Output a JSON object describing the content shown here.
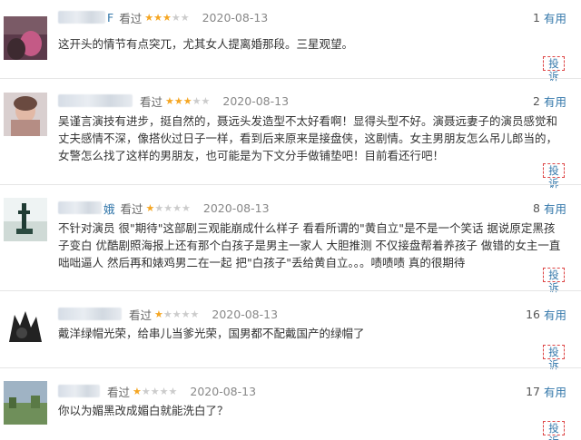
{
  "reviews": [
    {
      "username_suffix": "F",
      "seen_label": "看过",
      "rating": 3,
      "date": "2020-08-13",
      "votes": "1",
      "useful_label": "有用",
      "text": "这开头的情节有点突兀，尤其女人提离婚那段。三星观望。",
      "report_label": "投诉"
    },
    {
      "username_suffix": "",
      "seen_label": "看过",
      "rating": 3,
      "date": "2020-08-13",
      "votes": "2",
      "useful_label": "有用",
      "text": "吴谨言演技有进步，挺自然的，聂远头发造型不太好看啊！显得头型不好。演聂远妻子的演员感觉和丈夫感情不深，像搭伙过日子一样，看到后来原来是接盘侠，这剧情。女主男朋友怎么吊儿郎当的，女警怎么找了这样的男朋友，也可能是为下文分手做铺垫吧！目前看还行吧！",
      "report_label": "投诉"
    },
    {
      "username_suffix": "娥",
      "seen_label": "看过",
      "rating": 1,
      "date": "2020-08-13",
      "votes": "8",
      "useful_label": "有用",
      "text": "不针对演员 很\"期待\"这部剧三观能崩成什么样子 看看所谓的\"黄自立\"是不是一个笑话 据说原定黑孩子变白 优酷剧照海报上还有那个白孩子是男主一家人 大胆推测 不仅接盘帮着养孩子 做错的女主一直咄咄逼人 然后再和婊鸡男二在一起 把\"白孩子\"丢给黄自立。。。啧啧啧 真的很期待",
      "report_label": "投诉"
    },
    {
      "username_suffix": "",
      "seen_label": "看过",
      "rating": 1,
      "date": "2020-08-13",
      "votes": "16",
      "useful_label": "有用",
      "text": "戴洋绿帽光荣，给串儿当爹光荣，国男都不配戴国产的绿帽了",
      "report_label": "投诉"
    },
    {
      "username_suffix": "",
      "seen_label": "看过",
      "rating": 1,
      "date": "2020-08-13",
      "votes": "17",
      "useful_label": "有用",
      "text": "你以为媚黑改成媚白就能洗白了？",
      "report_label": "投诉"
    }
  ],
  "colors": {
    "star_on": "#f5a623",
    "star_off": "#cccccc",
    "link": "#3377aa",
    "report_border": "#dd4444"
  }
}
